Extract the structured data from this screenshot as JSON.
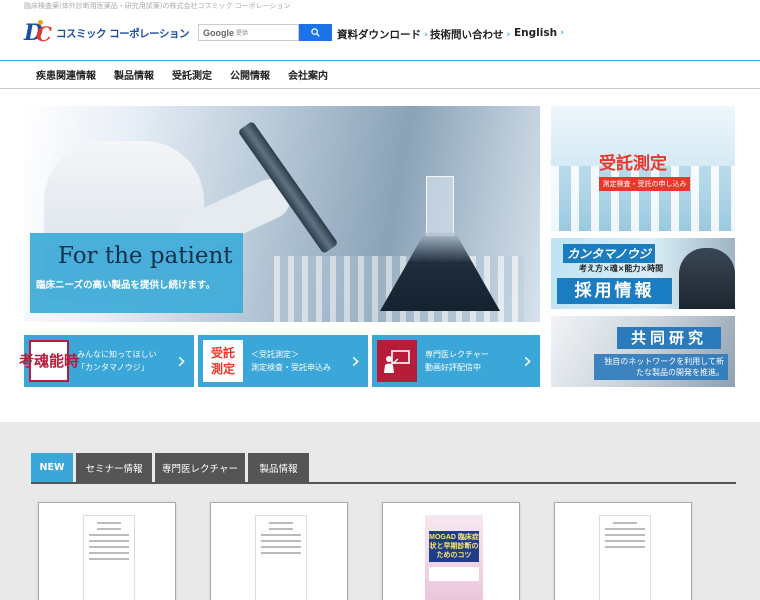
{
  "header": {
    "tagline": "臨床検査薬(体外診断用医薬品・研究用試薬)の株式会社コスミック コーポレーション",
    "logo_text": "コスミック コーポレーション",
    "search": {
      "google": "Google",
      "powered": "提供"
    },
    "links": [
      {
        "label": "資料ダウンロード"
      },
      {
        "label": "技術問い合わせ"
      },
      {
        "label": "English"
      }
    ]
  },
  "nav": {
    "items": [
      "疾患関連情報",
      "製品情報",
      "受託測定",
      "公開情報",
      "会社案内"
    ]
  },
  "hero": {
    "title": "For the patient",
    "subtitle": "臨床ニーズの高い製品を提供し続けます。"
  },
  "right_banners": {
    "contract": {
      "title": "受託測定",
      "sub": "測定検査・受託の申し込み"
    },
    "recruit": {
      "t1": "カンタマノウジ",
      "t2": "考え方×魂×能力×時間",
      "t3": "採用情報"
    },
    "joint": {
      "title": "共同研究",
      "sub": "独自のネットワークを利用して新たな製品の開発を推進。"
    }
  },
  "tiles": [
    {
      "icon_chars": [
        "考",
        "魂",
        "能",
        "時"
      ],
      "line1": "みんなに知ってほしい",
      "line2": "「カンタマノウジ」"
    },
    {
      "icon_chars": [
        "受託",
        "測定"
      ],
      "line1": "＜受託測定＞",
      "line2": "測定検査・受託申込み"
    },
    {
      "line1": "専門医レクチャー",
      "line2": "動画好評配信中"
    }
  ],
  "tabs": [
    "NEW",
    "セミナー情報",
    "専門医レクチャー",
    "製品情報"
  ],
  "poster": {
    "title": "MOGAD 臨床症状と早期診断のためのコツ"
  },
  "colors": {
    "accent": "#3aa7d8",
    "brand_blue": "#1c4fa1",
    "brand_red": "#e8382b",
    "dark_tab": "#555555"
  }
}
